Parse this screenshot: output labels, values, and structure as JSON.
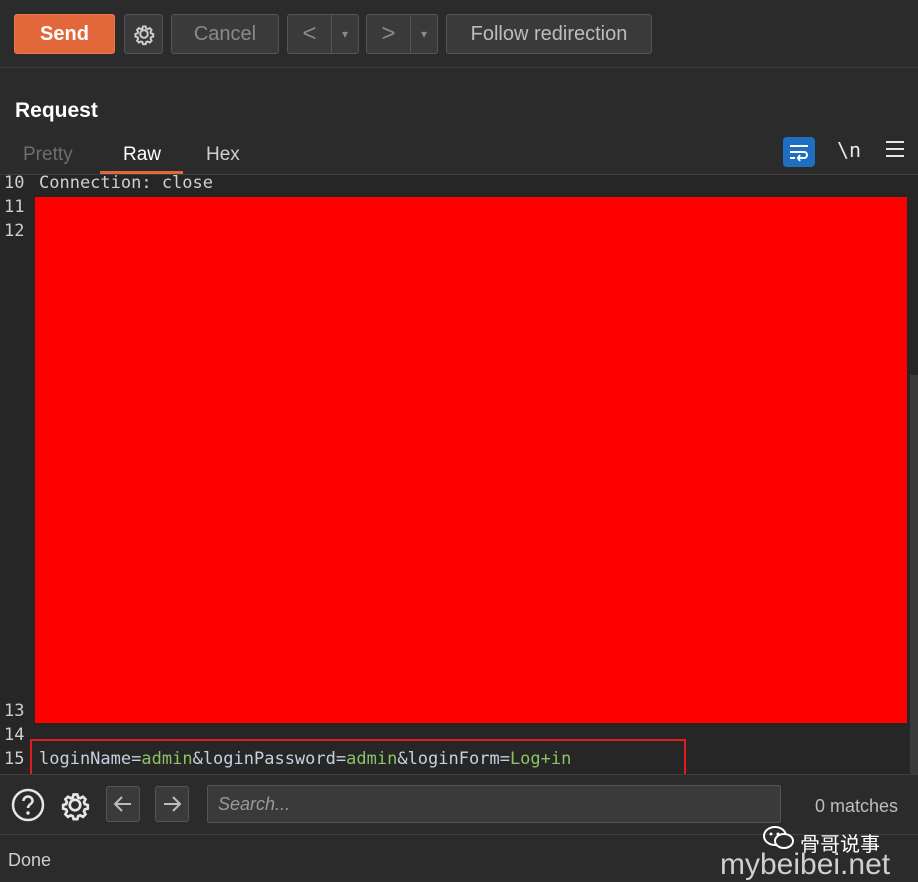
{
  "toolbar": {
    "send_label": "Send",
    "cancel_label": "Cancel",
    "back_label": "<",
    "forward_label": ">",
    "dropdown_glyph": "▾",
    "follow_label": "Follow redirection"
  },
  "request": {
    "title": "Request",
    "tabs": [
      {
        "label": "Pretty",
        "active": false
      },
      {
        "label": "Raw",
        "active": true
      },
      {
        "label": "Hex",
        "active": false
      }
    ],
    "newline_label": "\\n"
  },
  "editor": {
    "lines": [
      {
        "num": "10",
        "text": "Connection: close"
      },
      {
        "num": "11",
        "text": ""
      },
      {
        "num": "12",
        "text": ""
      },
      {
        "num": "13",
        "text": ""
      },
      {
        "num": "14",
        "text": ""
      },
      {
        "num": "15",
        "text": ""
      }
    ],
    "body_params": [
      {
        "key": "loginName",
        "value": "admin"
      },
      {
        "key": "loginPassword",
        "value": "admin"
      },
      {
        "key": "loginForm",
        "value": "Log+in"
      }
    ],
    "redaction_color": "#ff0000",
    "highlight_color": "#e11c1c"
  },
  "search": {
    "placeholder": "Search...",
    "matches": "0 matches"
  },
  "status": {
    "text": "Done"
  },
  "watermark": {
    "name": "骨哥说事",
    "site": "mybeibei.net"
  },
  "colors": {
    "accent": "#e2673a",
    "wrap_button": "#1e6fc2",
    "param_value": "#8cc265"
  }
}
